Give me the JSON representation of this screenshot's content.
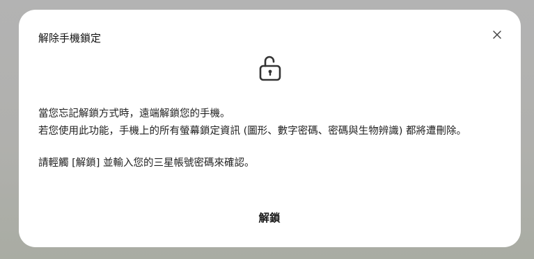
{
  "dialog": {
    "title": "解除手機鎖定",
    "close_icon": "close-icon",
    "lock_icon": "unlocked-padlock-icon",
    "paragraph_1": "當您忘記解鎖方式時，遠端解鎖您的手機。",
    "paragraph_2": "若您使用此功能，手機上的所有螢幕鎖定資訊 (圖形、數字密碼、密碼與生物辨識) 都將遭刪除。",
    "paragraph_3": "請輕觸 [解鎖] 並輸入您的三星帳號密碼來確認。",
    "unlock_button": "解鎖"
  }
}
